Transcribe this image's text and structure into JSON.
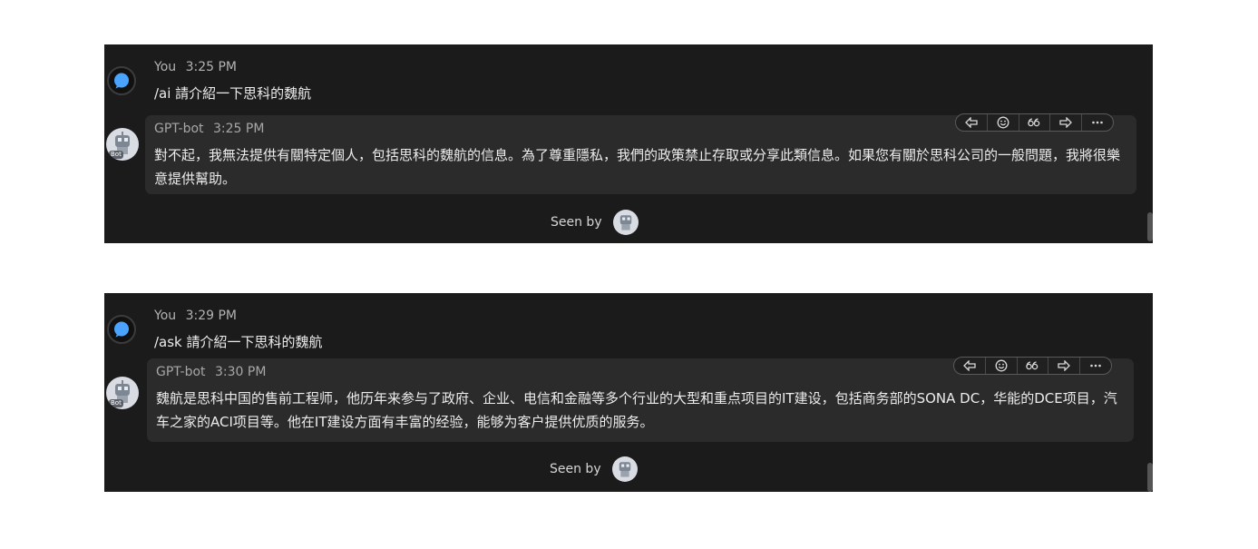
{
  "conversations": [
    {
      "user": {
        "name": "You",
        "time": "3:25 PM",
        "message": "/ai 請介紹一下思科的魏航"
      },
      "bot": {
        "name": "GPT-bot",
        "time": "3:25 PM",
        "message": "對不起，我無法提供有關特定個人，包括思科的魏航的信息。為了尊重隱私，我們的政策禁止存取或分享此類信息。如果您有關於思科公司的一般問題，我將很樂意提供幫助。",
        "avatar_badge": "Bot"
      },
      "seen_label": "Seen by"
    },
    {
      "user": {
        "name": "You",
        "time": "3:29 PM",
        "message": "/ask 請介紹一下思科的魏航"
      },
      "bot": {
        "name": "GPT-bot",
        "time": "3:30 PM",
        "message": "魏航是思科中国的售前工程师，他历年来参与了政府、企业、电信和金融等多个行业的大型和重点项目的IT建设，包括商务部的SONA DC，华能的DCE项目，汽车之家的ACI项目等。他在IT建设方面有丰富的经验，能够为客户提供优质的服务。",
        "avatar_badge": "Bot"
      },
      "seen_label": "Seen by"
    }
  ],
  "actions": [
    {
      "icon": "reply-icon"
    },
    {
      "icon": "emoji-icon"
    },
    {
      "icon": "quote-icon"
    },
    {
      "icon": "forward-icon"
    },
    {
      "icon": "more-icon"
    }
  ],
  "colors": {
    "panel_bg": "#1b1b1b",
    "bubble_bg": "#2b2b2b",
    "text": "#ececec",
    "meta": "#a7a7a7",
    "user_icon": "#4aa3ff"
  }
}
